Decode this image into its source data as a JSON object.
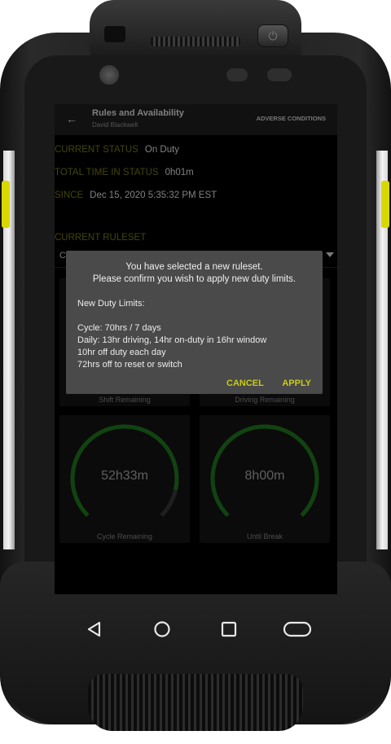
{
  "app": {
    "title": "Rules and Availability",
    "subtitle": "David Blackwell",
    "adverse_label": "ADVERSE CONDITIONS",
    "back_icon": "arrow-left-icon"
  },
  "status": {
    "current_status_label": "CURRENT STATUS",
    "current_status_value": "On Duty",
    "total_time_label": "TOTAL TIME IN STATUS",
    "total_time_value": "0h01m",
    "since_label": "SINCE",
    "since_value": "Dec 15, 2020 5:35:32 PM EST"
  },
  "ruleset": {
    "label": "CURRENT RULESET",
    "selected_value": "C"
  },
  "cards": [
    {
      "label": "Shift Remaining",
      "value": ""
    },
    {
      "label": "Driving Remaining",
      "value": ""
    },
    {
      "label": "Cycle Remaining",
      "value": "52h33m",
      "progress": 0.88
    },
    {
      "label": "Until Break",
      "value": "8h00m",
      "progress": 1.0
    }
  ],
  "dialog": {
    "message_line1": "You have selected a new ruleset.",
    "message_line2": "Please confirm you wish to apply new duty limits.",
    "limits_title": "New Duty Limits:",
    "limits": [
      "Cycle: 70hrs / 7 days",
      "Daily: 13hr driving, 14hr on-duty in 16hr window",
      "10hr off duty each day",
      "72hrs off to reset or switch"
    ],
    "cancel_label": "CANCEL",
    "apply_label": "APPLY"
  },
  "colors": {
    "accent": "#c8cc14",
    "label_olive": "#7a7f14",
    "gauge_green": "#1f7a1f",
    "gauge_track": "#3a3a3a"
  },
  "nav": {
    "back_icon": "triangle-back-icon",
    "home_icon": "circle-home-icon",
    "recents_icon": "square-recents-icon",
    "extra_icon": "rounded-rect-icon"
  }
}
